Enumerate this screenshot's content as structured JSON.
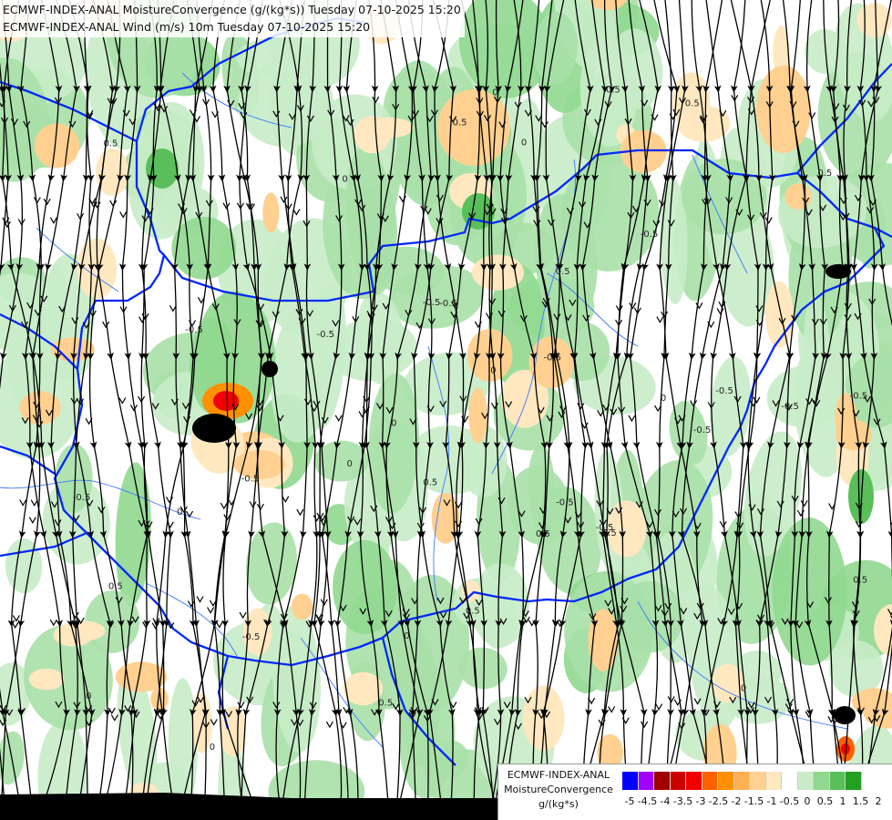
{
  "titles": {
    "line1": "ECMWF-INDEX-ANAL MoistureConvergence (g/(kg*s)) Tuesday 07-10-2025 15:20",
    "line2": "ECMWF-INDEX-ANAL Wind (m/s) 10m Tuesday 07-10-2025 15:20"
  },
  "legend": {
    "model": "ECMWF-INDEX-ANAL",
    "parameter": "MoistureConvergence",
    "unit": "g/(kg*s)",
    "tick_labels": [
      "-5",
      "-4.5",
      "-4",
      "-3.5",
      "-3",
      "-2.5",
      "-2",
      "-1.5",
      "-1",
      "-0.5",
      "0",
      "0.5",
      "1",
      "1.5",
      "2"
    ],
    "colors": [
      "#0000ff",
      "#a000ff",
      "#a00000",
      "#cc0000",
      "#f00000",
      "#ff6000",
      "#ff9000",
      "#ffb050",
      "#ffd090",
      "#ffe8c0",
      "#ffffff",
      "#c8ecc8",
      "#90d890",
      "#5abf5a",
      "#22a022"
    ]
  },
  "map": {
    "border_color": "#0028ff",
    "river_color": "#3c78ff",
    "contour_labels": [
      "0",
      "0.5",
      "-0.5",
      "-1"
    ]
  }
}
